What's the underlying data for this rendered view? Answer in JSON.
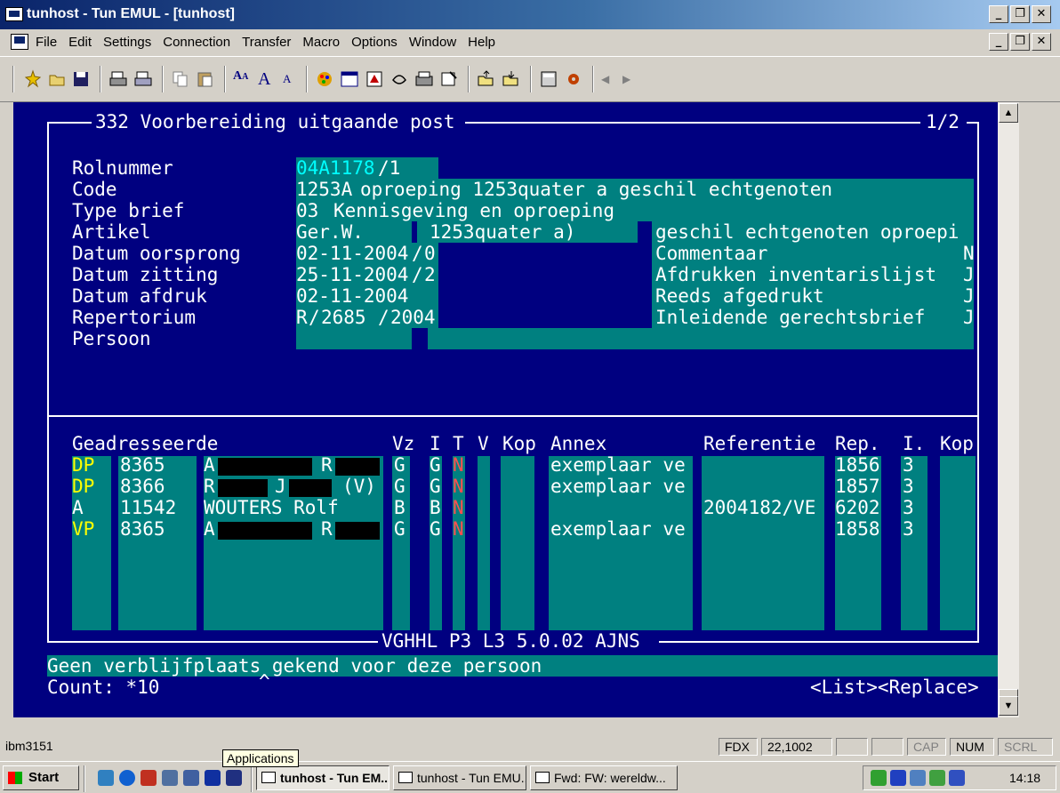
{
  "window": {
    "title": "tunhost - Tun EMUL - [tunhost]"
  },
  "menu": {
    "items": [
      "File",
      "Edit",
      "Settings",
      "Connection",
      "Transfer",
      "Macro",
      "Options",
      "Window",
      "Help"
    ]
  },
  "toolbar": {
    "icons": [
      "new-session-icon",
      "open-icon",
      "save-icon",
      "print-icon",
      "print-setup-icon",
      "copy-icon",
      "paste-icon",
      "font-icon",
      "font-larger-icon",
      "font-smaller-icon",
      "colors-icon",
      "keyboard-icon",
      "macro-icon",
      "hotspot-icon",
      "print-screen-icon",
      "properties-icon",
      "transfer-send-icon",
      "transfer-receive-icon",
      "calculator-icon",
      "settings-icon",
      "scroll-left-icon",
      "scroll-right-icon"
    ]
  },
  "screen": {
    "header": {
      "title": "332 Voorbereiding uitgaande post",
      "page": "1/2"
    },
    "labels": [
      "Rolnummer",
      "Code",
      "Type brief",
      "Artikel",
      "Datum oorsprong",
      "Datum zitting",
      "Datum afdruk",
      "Repertorium",
      "Persoon"
    ],
    "rolnummer": {
      "value": "04A1178",
      "suffix": "/1"
    },
    "code": {
      "value": "1253A",
      "desc": "oproeping 1253quater a geschil echtgenoten"
    },
    "type_brief": {
      "value": "03",
      "desc": "Kennisgeving en oproeping"
    },
    "artikel": {
      "wetboek": "Ger.W.",
      "artikel": "1253quater a)",
      "desc": "geschil echtgenoten oproepi"
    },
    "datum_oorsprong": {
      "date": "02-11-2004",
      "sep": "/",
      "seq": "0"
    },
    "datum_zitting": {
      "date": "25-11-2004",
      "sep": "/",
      "seq": "2"
    },
    "datum_afdruk": {
      "date": "02-11-2004"
    },
    "repertorium": {
      "prefix": "R",
      "sep1": "/",
      "number": "2685",
      "sep2": "/",
      "year": "2004"
    },
    "flags": [
      {
        "label": "Commentaar",
        "value": "N"
      },
      {
        "label": "Afdrukken inventarislijst",
        "value": "J"
      },
      {
        "label": "Reeds afgedrukt",
        "value": "J"
      },
      {
        "label": "Inleidende gerechtsbrief",
        "value": "J"
      }
    ],
    "table": {
      "headers": {
        "geadresseerde": "Geadresseerde",
        "vz": "Vz",
        "i": "I",
        "t": "T",
        "v": "V",
        "kop": "Kop",
        "annex": "Annex",
        "referentie": "Referentie",
        "rep": "Rep.",
        "i2": "I.",
        "kop2": "Kop"
      },
      "rows": [
        {
          "type": "DP",
          "nr": "8365",
          "name1": "A",
          "name2": "R",
          "extra": "",
          "vz": "G",
          "i": "G",
          "t": "N",
          "annex": "exemplaar ve",
          "ref": "",
          "rep": "1856",
          "i2": "3"
        },
        {
          "type": "DP",
          "nr": "8366",
          "name1": "R",
          "name2": "J",
          "extra": "(V)",
          "vz": "G",
          "i": "G",
          "t": "N",
          "annex": "exemplaar ve",
          "ref": "",
          "rep": "1857",
          "i2": "3"
        },
        {
          "type": "A",
          "nr": "11542",
          "name1": "WOUTERS Rolf",
          "name2": "",
          "extra": "",
          "vz": "B",
          "i": "B",
          "t": "N",
          "annex": "",
          "ref": "2004182/VE",
          "rep": "6202",
          "i2": "3"
        },
        {
          "type": "VP",
          "nr": "8365",
          "name1": "A",
          "name2": "R",
          "extra": "",
          "vz": "G",
          "i": "G",
          "t": "N",
          "annex": "exemplaar ve",
          "ref": "",
          "rep": "1858",
          "i2": "3"
        }
      ]
    },
    "footer_id": "VGHHL P3 L3 5.0.02 AJNS",
    "message": "Geen verblijfplaats gekend voor deze persoon",
    "count": "Count: *10",
    "caret": "^",
    "keys": "<List><Replace>"
  },
  "statusbar": {
    "terminal": "ibm3151",
    "mode": "FDX",
    "position": "22,1002",
    "cap": "CAP",
    "num": "NUM",
    "scrl": "SCRL"
  },
  "taskbar": {
    "start": "Start",
    "tooltip": "Applications",
    "tasks": [
      "tunhost - Tun EM...",
      "tunhost - Tun EMU...",
      "Fwd: FW: wereldw..."
    ],
    "clock": "14:18"
  },
  "colors": {
    "terminal_bg": "#000080",
    "field_bg": "#008080",
    "titlebar": "#0a246a"
  }
}
